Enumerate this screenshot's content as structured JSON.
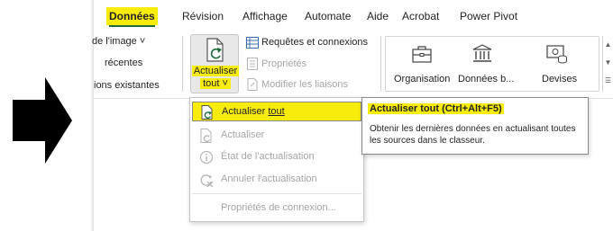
{
  "tabs": [
    "Données",
    "Révision",
    "Affichage",
    "Automate",
    "Aide",
    "Acrobat",
    "Power Pivot"
  ],
  "active_tab": "Données",
  "ribbon": {
    "left_items": [
      "de l'image ˅",
      "récentes",
      "ions existantes"
    ],
    "refresh_all": {
      "line1": "Actualiser",
      "line2": "tout ˅"
    },
    "queries": [
      {
        "label": "Requêtes et connexions",
        "enabled": true
      },
      {
        "label": "Propriétés",
        "enabled": false
      },
      {
        "label": "Modifier les liaisons",
        "enabled": false
      }
    ],
    "gallery": [
      "Organisation",
      "Données b...",
      "Devises"
    ]
  },
  "menu": {
    "items": [
      {
        "label": "Actualiser ",
        "accel": "tout",
        "icon": "refresh-all-icon",
        "highlighted": true
      },
      {
        "label": "Actualiser",
        "icon": "refresh-icon"
      },
      {
        "label": "État de l'actualisation",
        "icon": "info-icon"
      },
      {
        "label": "Annuler l'actualisation",
        "icon": "cancel-refresh-icon"
      },
      {
        "label": "Propriétés de connexion..."
      }
    ]
  },
  "tooltip": {
    "title": "Actualiser tout (Ctrl+Alt+F5)",
    "description": "Obtenir les dernières données en actualisant toutes les sources dans le classeur."
  },
  "colors": {
    "highlight": "#f7ec0c",
    "excel_green": "#1f6b3b",
    "disabled_text": "#a6a6a6"
  }
}
